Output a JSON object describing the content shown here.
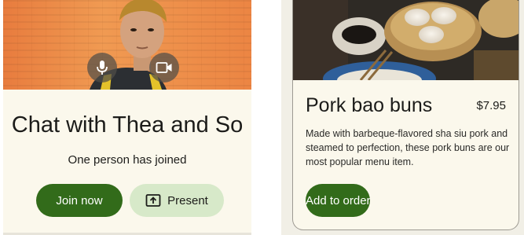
{
  "meeting_card": {
    "title": "Chat with Thea and So",
    "status": "One person has joined",
    "mic_icon": "mic-icon",
    "camera_icon": "videocam-icon",
    "join_label": "Join now",
    "present_label": "Present",
    "present_icon": "present-to-all-icon"
  },
  "food_card": {
    "name": "Pork bao buns",
    "price": "$7.95",
    "description": "Made with barbeque-flavored sha siu pork and steamed to perfection, these pork buns are our most popular menu item.",
    "order_label": "Add to order"
  },
  "colors": {
    "primary": "#326b1a",
    "secondary_container": "#d7e9c9",
    "surface": "#fbf8ec",
    "on_surface": "#1c1c1a"
  }
}
